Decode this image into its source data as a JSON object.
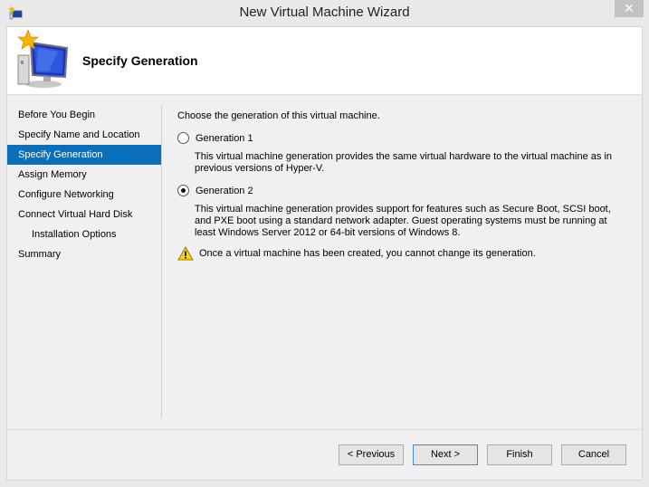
{
  "window": {
    "title": "New Virtual Machine Wizard",
    "close_label": "✕"
  },
  "header": {
    "page_title": "Specify Generation"
  },
  "sidebar": {
    "items": [
      {
        "label": "Before You Begin",
        "active": false,
        "sub": false
      },
      {
        "label": "Specify Name and Location",
        "active": false,
        "sub": false
      },
      {
        "label": "Specify Generation",
        "active": true,
        "sub": false
      },
      {
        "label": "Assign Memory",
        "active": false,
        "sub": false
      },
      {
        "label": "Configure Networking",
        "active": false,
        "sub": false
      },
      {
        "label": "Connect Virtual Hard Disk",
        "active": false,
        "sub": false
      },
      {
        "label": "Installation Options",
        "active": false,
        "sub": true
      },
      {
        "label": "Summary",
        "active": false,
        "sub": false
      }
    ]
  },
  "content": {
    "intro": "Choose the generation of this virtual machine.",
    "options": [
      {
        "label": "Generation 1",
        "selected": false,
        "description": "This virtual machine generation provides the same virtual hardware to the virtual machine as in previous versions of Hyper-V."
      },
      {
        "label": "Generation 2",
        "selected": true,
        "description": "This virtual machine generation provides support for features such as Secure Boot, SCSI boot, and PXE boot using a standard network adapter. Guest operating systems must be running at least Windows Server 2012 or 64-bit versions of Windows 8."
      }
    ],
    "warning": "Once a virtual machine has been created, you cannot change its generation."
  },
  "footer": {
    "previous_label": "< Previous",
    "next_label": "Next >",
    "finish_label": "Finish",
    "cancel_label": "Cancel"
  },
  "colors": {
    "selection": "#0a6fbb",
    "default_button_border": "#3c8fd8"
  }
}
